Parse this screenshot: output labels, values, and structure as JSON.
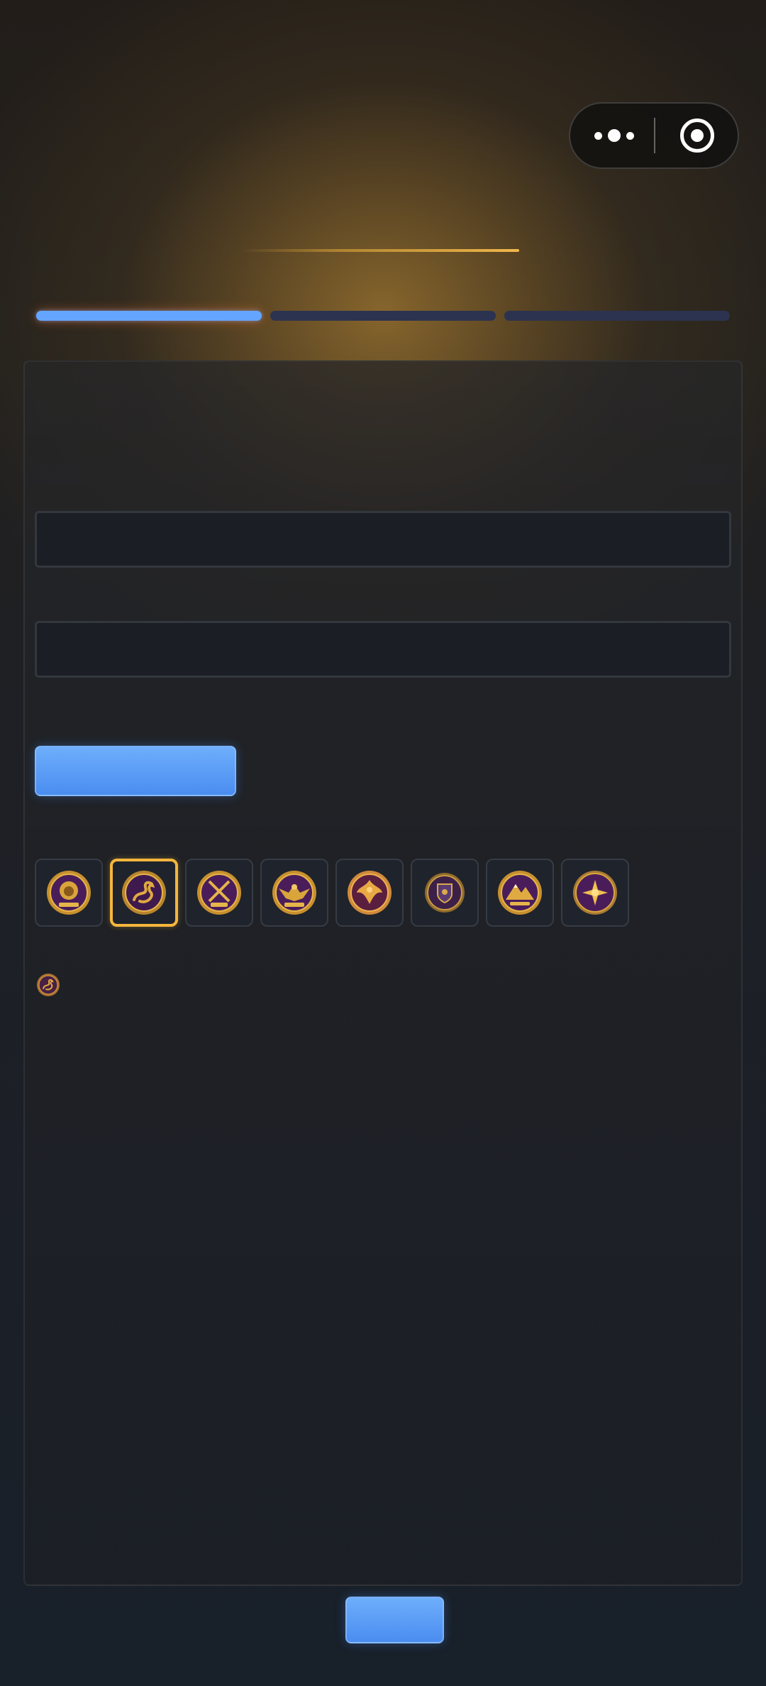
{
  "colors": {
    "accent_blue": "#64a6ff",
    "button_blue": "#4a8df0",
    "step_inactive": "#2c3350",
    "selected_border": "#f5b63d",
    "emblem_purple": "#4a1d5a",
    "emblem_gold": "#d9a53a"
  },
  "header": {
    "menu": {
      "more_icon": "more-dots-icon",
      "close_icon": "target-circle-icon"
    }
  },
  "steps": {
    "total": 3,
    "current": 1
  },
  "form": {
    "field1": {
      "value": "",
      "placeholder": ""
    },
    "field2": {
      "value": "",
      "placeholder": ""
    },
    "action_button_label": ""
  },
  "emblems": {
    "selected_index": 1,
    "items": [
      {
        "icon": "lion-emblem-icon"
      },
      {
        "icon": "dragon-emblem-icon"
      },
      {
        "icon": "crossed-swords-emblem-icon"
      },
      {
        "icon": "eagle-emblem-icon"
      },
      {
        "icon": "phoenix-emblem-icon"
      },
      {
        "icon": "shield-emblem-icon"
      },
      {
        "icon": "mountain-emblem-icon"
      },
      {
        "icon": "star-emblem-icon"
      }
    ]
  },
  "footer": {
    "submit_label": ""
  }
}
